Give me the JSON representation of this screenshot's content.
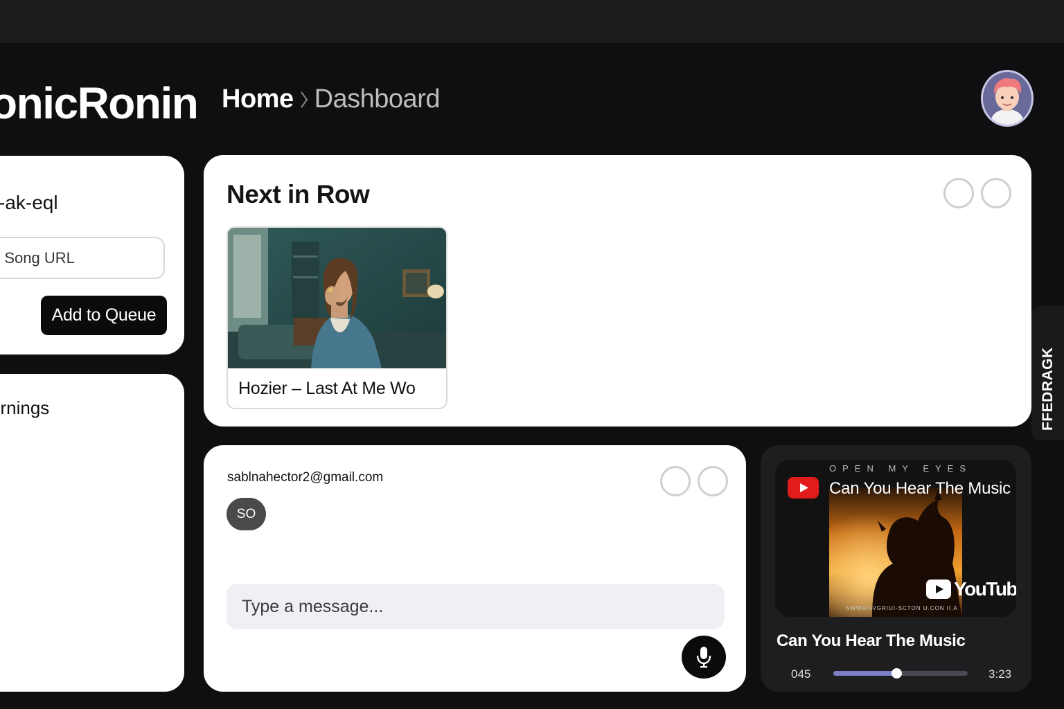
{
  "header": {
    "brand": "onicRonin",
    "breadcrumb": {
      "home": "Home",
      "current": "Dashboard"
    }
  },
  "sidebar": {
    "room_code": "-ak-eql",
    "song_url_placeholder": "d Song URL",
    "add_button_label": "Add to Queue",
    "members_label": "ernings"
  },
  "next_in_row": {
    "title": "Next in Row",
    "items": [
      {
        "title": "Hozier – Last At Me Wo"
      }
    ]
  },
  "chat": {
    "email": "sablnahector2@gmail.com",
    "initials": "SO",
    "message_placeholder": "Type a message..."
  },
  "player": {
    "video_kicker": "OPEN MY EYES",
    "video_title": "Can You Hear The Music",
    "video_url": "SWWAIAVGRIUI-SCTON U.CON II.A",
    "youtube_wordmark": "YouTube",
    "song_title": "Can You Hear The Music",
    "elapsed": "045",
    "duration": "3:23",
    "progress_fraction": 0.47
  },
  "feedback": {
    "label": "FFEDRAGK"
  },
  "colors": {
    "page_background": "#0f0f11",
    "card_background": "#ffffff",
    "player_background": "#1e1e21",
    "progress_accent": "#7d7fc6",
    "youtube_red": "#e21b1b",
    "button_dark": "#0b0b0b"
  },
  "icons": {
    "breadcrumb_separator": "chevron-right-icon",
    "microphone": "microphone-icon",
    "youtube": "youtube-play-icon"
  }
}
